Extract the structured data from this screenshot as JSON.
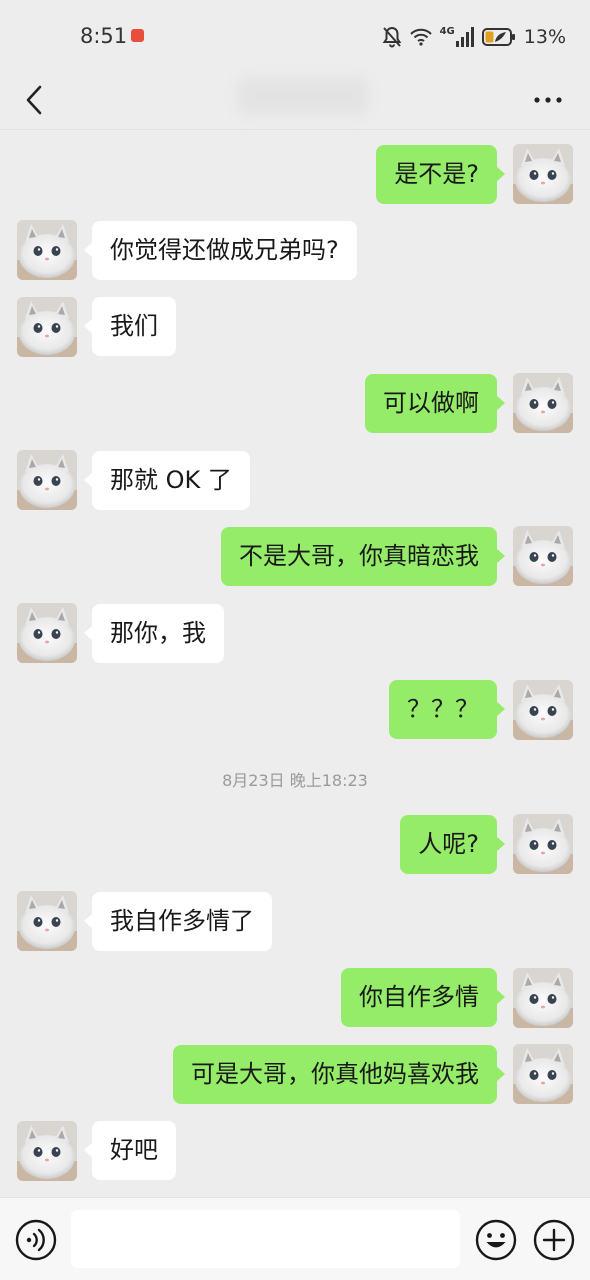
{
  "status_bar": {
    "time": "8:51",
    "network": "4G",
    "battery": "13%",
    "icons": [
      "notification-app-icon",
      "mute-bell-icon",
      "wifi-icon",
      "signal-icon",
      "battery-icon"
    ]
  },
  "nav": {
    "back_icon": "chevron-left-icon",
    "more_icon": "ellipsis-icon",
    "title_blurred": true
  },
  "messages": [
    {
      "side": "out",
      "text": "是不是?"
    },
    {
      "side": "in",
      "text": "你觉得还做成兄弟吗?"
    },
    {
      "side": "in",
      "text": "我们"
    },
    {
      "side": "out",
      "text": "可以做啊"
    },
    {
      "side": "in",
      "text": "那就 OK 了"
    },
    {
      "side": "out",
      "text": "不是大哥，你真暗恋我"
    },
    {
      "side": "in",
      "text": "那你，我"
    },
    {
      "side": "out",
      "text": "？？？"
    },
    {
      "type": "timestamp",
      "text": "8月23日 晚上18:23"
    },
    {
      "side": "out",
      "text": "人呢?"
    },
    {
      "side": "in",
      "text": "我自作多情了"
    },
    {
      "side": "out",
      "text": "你自作多情"
    },
    {
      "side": "out",
      "text": "可是大哥，你真他妈喜欢我"
    },
    {
      "side": "in",
      "text": "好吧"
    }
  ],
  "input_bar": {
    "voice_icon": "voice-icon",
    "emoji_icon": "emoji-icon",
    "plus_icon": "plus-icon",
    "input_value": ""
  },
  "colors": {
    "background": "#ededed",
    "incoming_bubble": "#ffffff",
    "outgoing_bubble": "#95ec69",
    "timestamp_text": "#9a9a9a"
  }
}
